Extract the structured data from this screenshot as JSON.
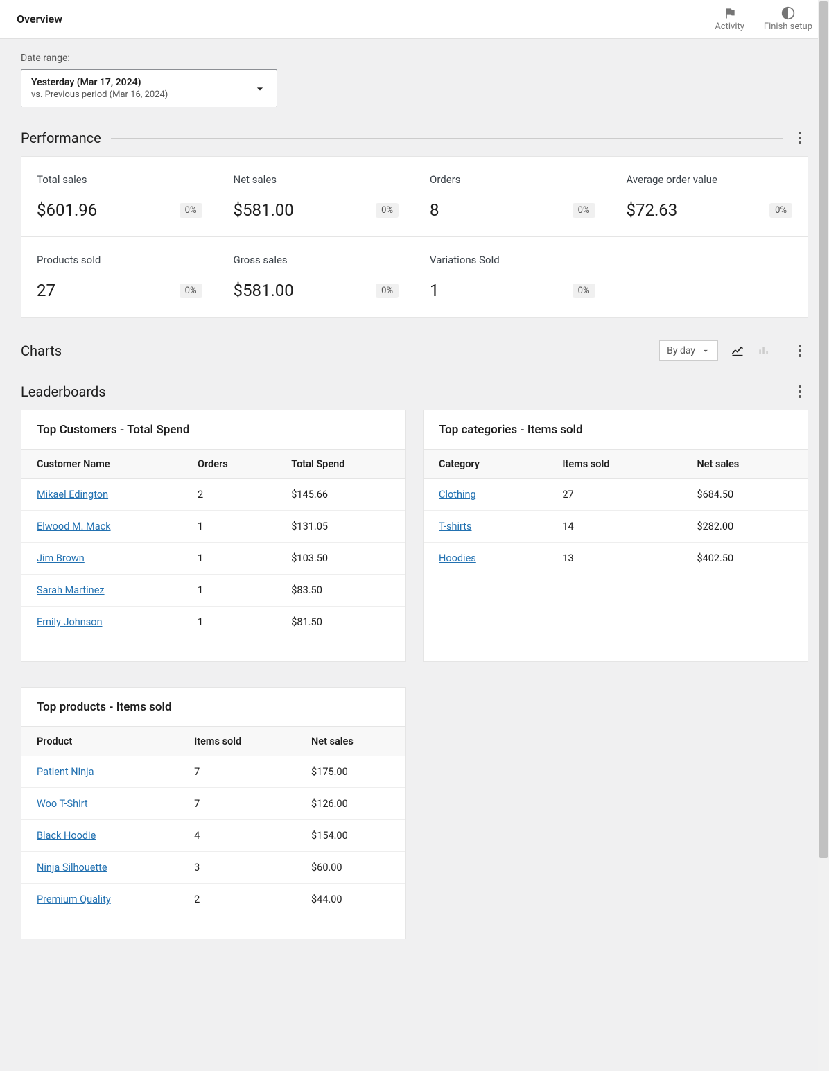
{
  "header": {
    "title": "Overview",
    "activity_label": "Activity",
    "finish_setup_label": "Finish setup"
  },
  "date_range": {
    "label": "Date range:",
    "primary": "Yesterday (Mar 17, 2024)",
    "secondary": "vs. Previous period (Mar 16, 2024)"
  },
  "sections": {
    "performance": "Performance",
    "charts": "Charts",
    "leaderboards": "Leaderboards"
  },
  "performance": [
    {
      "label": "Total sales",
      "value": "$601.96",
      "delta": "0%"
    },
    {
      "label": "Net sales",
      "value": "$581.00",
      "delta": "0%"
    },
    {
      "label": "Orders",
      "value": "8",
      "delta": "0%"
    },
    {
      "label": "Average order value",
      "value": "$72.63",
      "delta": "0%"
    },
    {
      "label": "Products sold",
      "value": "27",
      "delta": "0%"
    },
    {
      "label": "Gross sales",
      "value": "$581.00",
      "delta": "0%"
    },
    {
      "label": "Variations Sold",
      "value": "1",
      "delta": "0%"
    }
  ],
  "charts": {
    "interval_label": "By day"
  },
  "leaderboards": {
    "top_customers": {
      "title": "Top Customers - Total Spend",
      "columns": [
        "Customer Name",
        "Orders",
        "Total Spend"
      ],
      "rows": [
        {
          "name": "Mikael Edington",
          "orders": "2",
          "spend": "$145.66"
        },
        {
          "name": "Elwood M. Mack",
          "orders": "1",
          "spend": "$131.05"
        },
        {
          "name": "Jim Brown",
          "orders": "1",
          "spend": "$103.50"
        },
        {
          "name": "Sarah Martinez",
          "orders": "1",
          "spend": "$83.50"
        },
        {
          "name": "Emily Johnson",
          "orders": "1",
          "spend": "$81.50"
        }
      ]
    },
    "top_categories": {
      "title": "Top categories - Items sold",
      "columns": [
        "Category",
        "Items sold",
        "Net sales"
      ],
      "rows": [
        {
          "name": "Clothing",
          "items": "27",
          "net": "$684.50"
        },
        {
          "name": "T-shirts",
          "items": "14",
          "net": "$282.00"
        },
        {
          "name": "Hoodies",
          "items": "13",
          "net": "$402.50"
        }
      ]
    },
    "top_products": {
      "title": "Top products - Items sold",
      "columns": [
        "Product",
        "Items sold",
        "Net sales"
      ],
      "rows": [
        {
          "name": "Patient Ninja",
          "items": "7",
          "net": "$175.00"
        },
        {
          "name": "Woo T-Shirt",
          "items": "7",
          "net": "$126.00"
        },
        {
          "name": "Black Hoodie",
          "items": "4",
          "net": "$154.00"
        },
        {
          "name": "Ninja Silhouette",
          "items": "3",
          "net": "$60.00"
        },
        {
          "name": "Premium Quality",
          "items": "2",
          "net": "$44.00"
        }
      ]
    }
  }
}
